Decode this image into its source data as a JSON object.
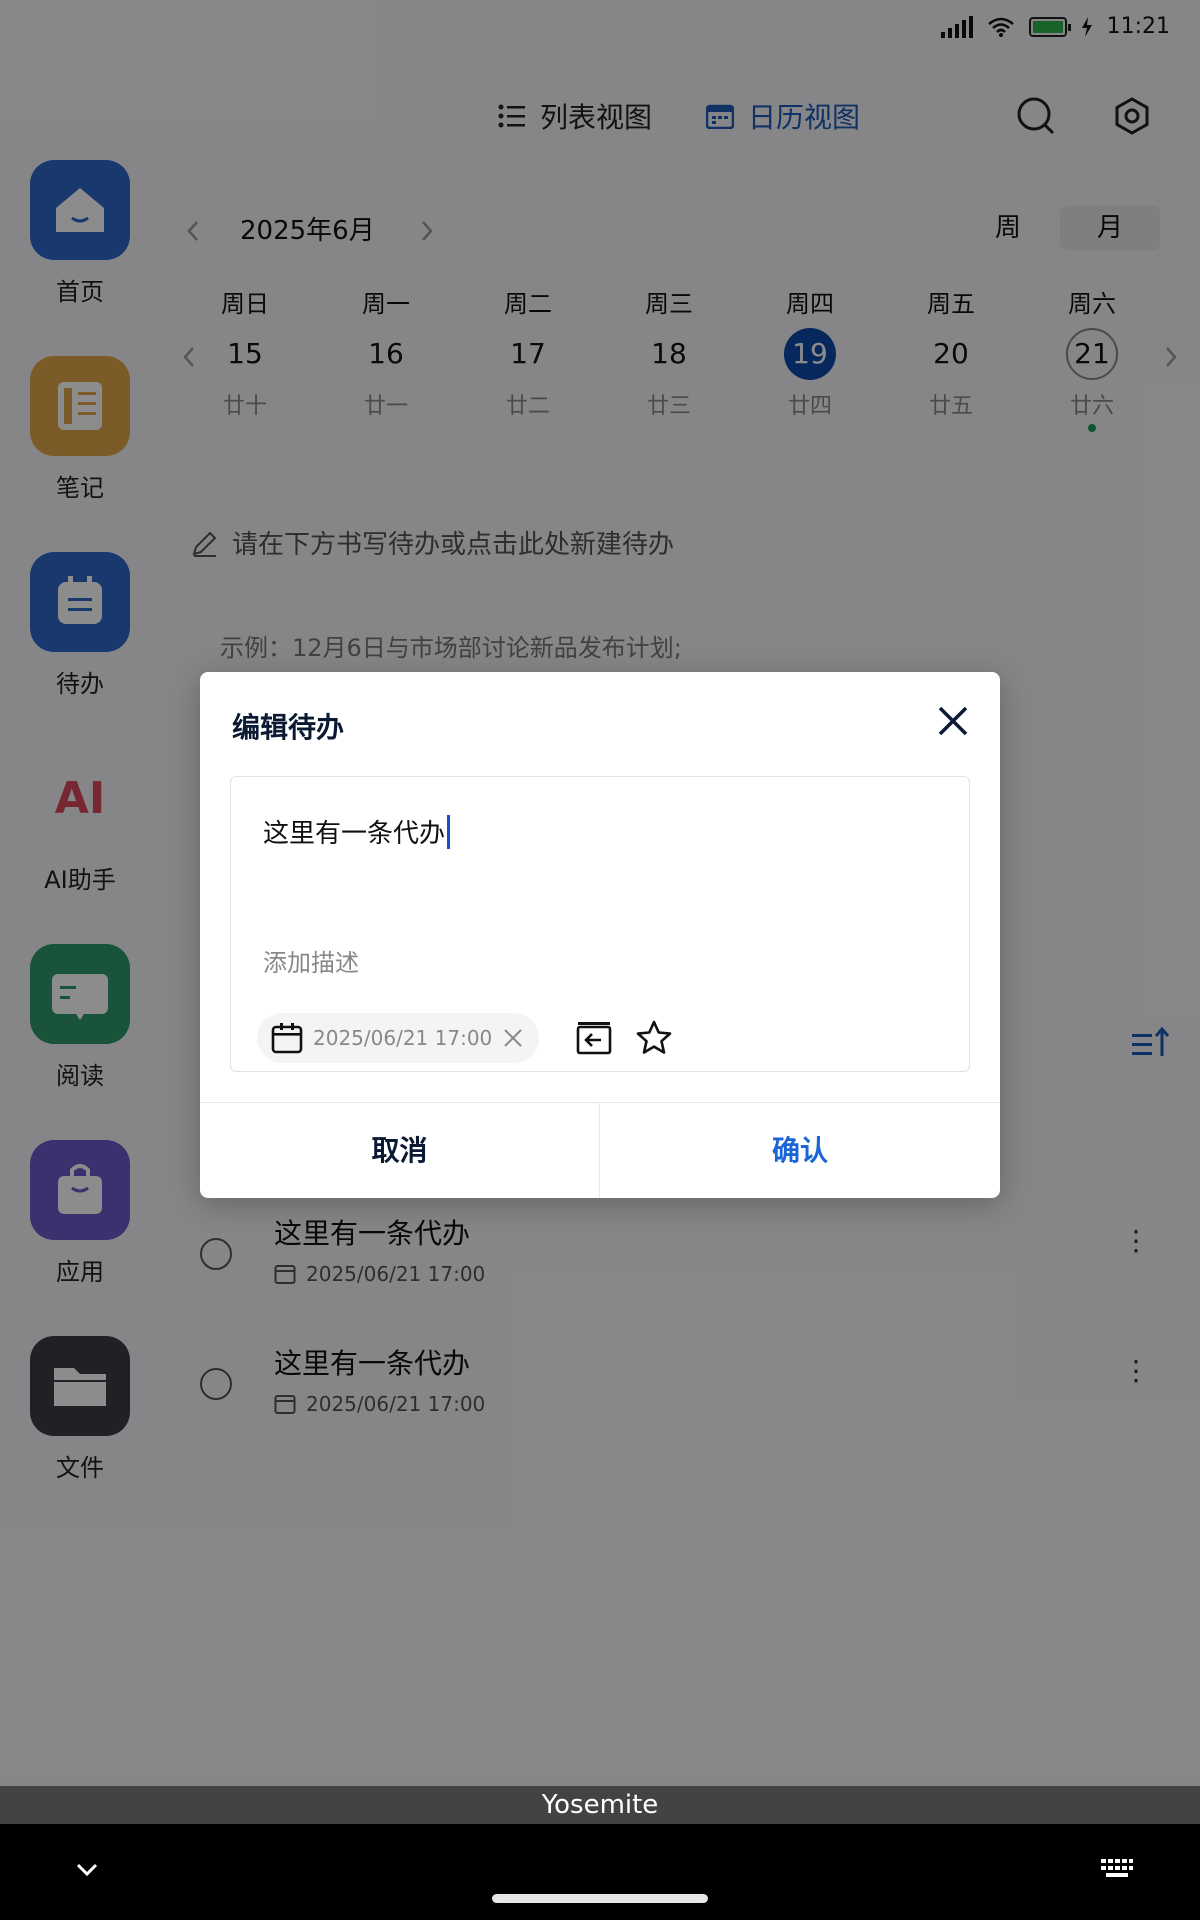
{
  "status": {
    "time": "11:21"
  },
  "rail": [
    {
      "label": "首页",
      "color": "#2c66c9",
      "icon": "home-icon"
    },
    {
      "label": "笔记",
      "color": "#e0a84c",
      "icon": "notebook-icon"
    },
    {
      "label": "待办",
      "color": "#2c66c9",
      "icon": "todo-icon"
    },
    {
      "label": "AI助手",
      "color": "#d9475c",
      "icon": "ai-icon",
      "glyph": "AI"
    },
    {
      "label": "阅读",
      "color": "#2f9a6a",
      "icon": "reading-icon"
    },
    {
      "label": "应用",
      "color": "#6b5ac9",
      "icon": "apps-icon"
    },
    {
      "label": "文件",
      "color": "#3a3d42",
      "icon": "folder-icon"
    }
  ],
  "views": {
    "list": "列表视图",
    "calendar": "日历视图"
  },
  "calendar": {
    "month": "2025年6月",
    "segments": {
      "week": "周",
      "month": "月"
    },
    "days": [
      {
        "wd": "周日",
        "num": "15",
        "lunar": "廿十"
      },
      {
        "wd": "周一",
        "num": "16",
        "lunar": "廿一"
      },
      {
        "wd": "周二",
        "num": "17",
        "lunar": "廿二"
      },
      {
        "wd": "周三",
        "num": "18",
        "lunar": "廿三"
      },
      {
        "wd": "周四",
        "num": "19",
        "lunar": "廿四"
      },
      {
        "wd": "周五",
        "num": "20",
        "lunar": "廿五"
      },
      {
        "wd": "周六",
        "num": "21",
        "lunar": "廿六"
      }
    ]
  },
  "hint": "请在下方书写待办或点击此处新建待办",
  "example": "示例：12月6日与市场部讨论新品发布计划;",
  "todos": [
    {
      "title": "这里有一条代办",
      "date": "2025/06/21 17:00"
    },
    {
      "title": "这里有一条代办",
      "date": "2025/06/21 17:00"
    }
  ],
  "dialog": {
    "title": "编辑待办",
    "todo_text": "这里有一条代办",
    "description_placeholder": "添加描述",
    "date": "2025/06/21 17:00",
    "cancel": "取消",
    "confirm": "确认"
  },
  "ime": {
    "label": "Yosemite"
  }
}
